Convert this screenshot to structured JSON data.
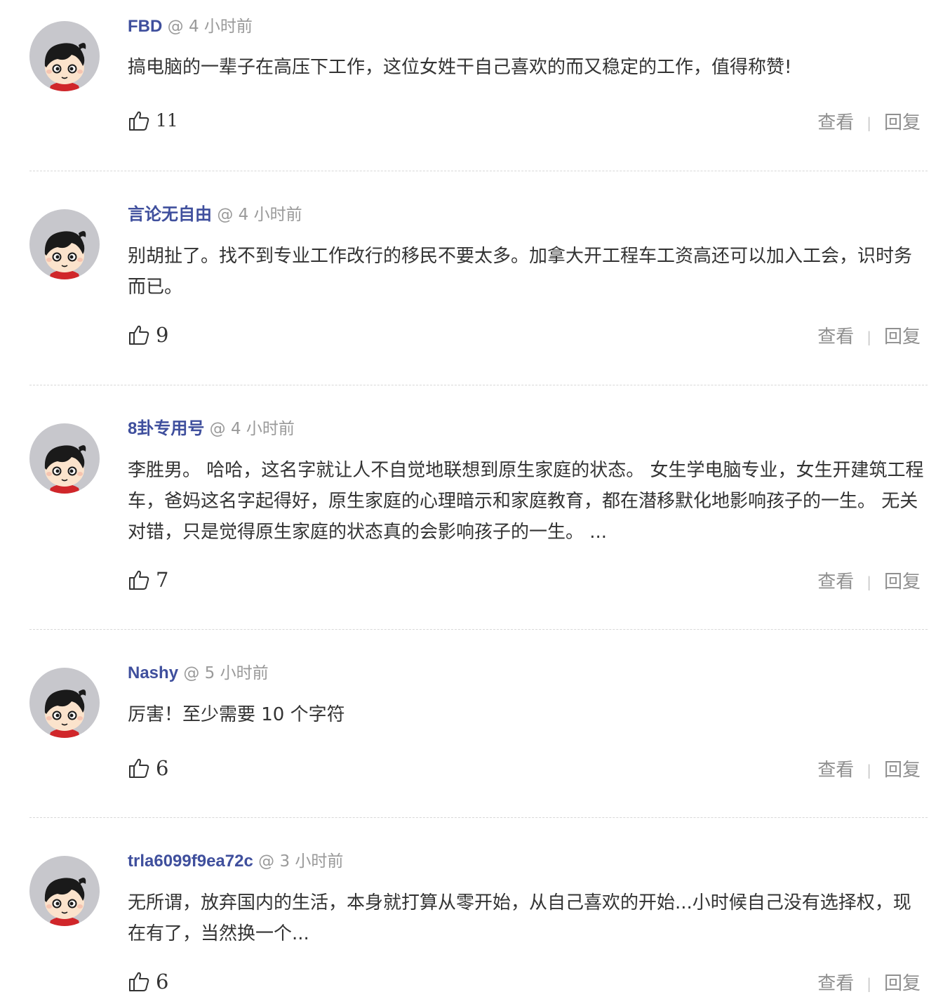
{
  "comments": [
    {
      "username": "FBD",
      "at": "@",
      "time": "4 小时前",
      "text": "搞电脑的一辈子在高压下工作，这位女姓干自己喜欢的而又稳定的工作，值得称赞!",
      "likes": "11",
      "view_label": "查看",
      "separator": "|",
      "reply_label": "回复"
    },
    {
      "username": "言论无自由",
      "at": "@",
      "time": "4 小时前",
      "text": "别胡扯了。找不到专业工作改行的移民不要太多。加拿大开工程车工资高还可以加入工会，识时务而已。",
      "likes": "9",
      "view_label": "查看",
      "separator": "|",
      "reply_label": "回复"
    },
    {
      "username": "8卦专用号",
      "at": "@",
      "time": "4 小时前",
      "text": "李胜男。 哈哈，这名字就让人不自觉地联想到原生家庭的状态。 女生学电脑专业，女生开建筑工程车，爸妈这名字起得好，原生家庭的心理暗示和家庭教育，都在潜移默化地影响孩子的一生。 无关对错，只是觉得原生家庭的状态真的会影响孩子的一生。 ...",
      "likes": "7",
      "view_label": "查看",
      "separator": "|",
      "reply_label": "回复"
    },
    {
      "username": "Nashy",
      "at": "@",
      "time": "5 小时前",
      "text": "厉害！至少需要 10 个字符",
      "likes": "6",
      "view_label": "查看",
      "separator": "|",
      "reply_label": "回复"
    },
    {
      "username": "trla6099f9ea72c",
      "at": "@",
      "time": "3 小时前",
      "text": "无所谓，放弃国内的生活，本身就打算从零开始，从自己喜欢的开始...小时候自己没有选择权，现在有了，当然换一个...",
      "likes": "6",
      "view_label": "查看",
      "separator": "|",
      "reply_label": "回复"
    }
  ],
  "icons": {
    "avatar": "default-cartoon-avatar-icon",
    "like": "thumbs-up-icon"
  },
  "colors": {
    "username": "#3f4f9d",
    "muted": "#9a9a9a",
    "text": "#333333",
    "divider": "#d8d8d8",
    "avatar_bg": "#c7c7cc"
  }
}
